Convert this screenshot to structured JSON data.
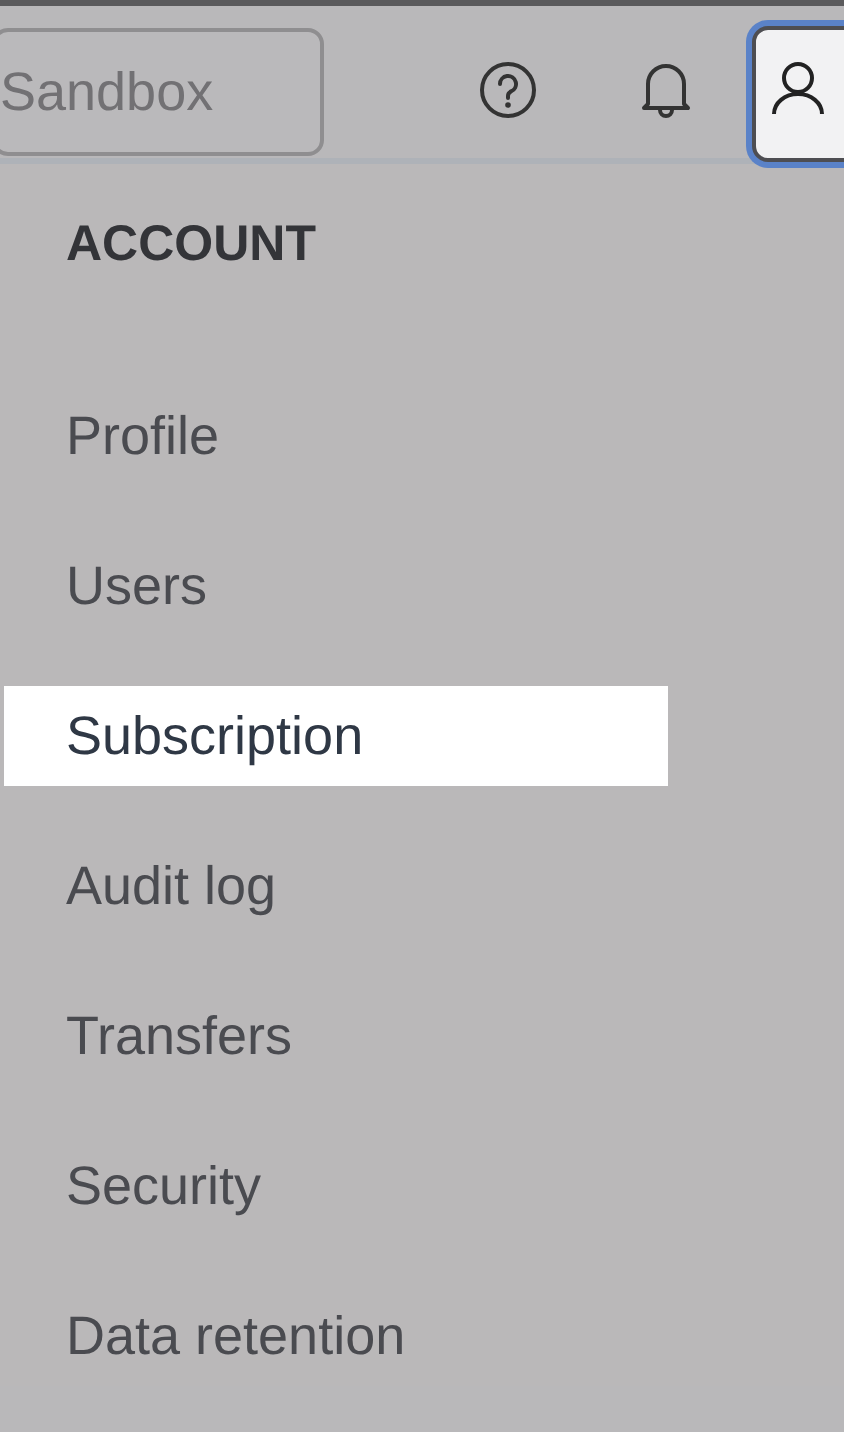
{
  "header": {
    "environment_button": "Sandbox"
  },
  "account_menu": {
    "open": true,
    "heading": "ACCOUNT",
    "items": [
      {
        "label": "Profile",
        "selected": false
      },
      {
        "label": "Users",
        "selected": false
      },
      {
        "label": "Subscription",
        "selected": true
      },
      {
        "label": "Audit log",
        "selected": false
      },
      {
        "label": "Transfers",
        "selected": false
      },
      {
        "label": "Security",
        "selected": false
      },
      {
        "label": "Data retention",
        "selected": false
      }
    ]
  }
}
